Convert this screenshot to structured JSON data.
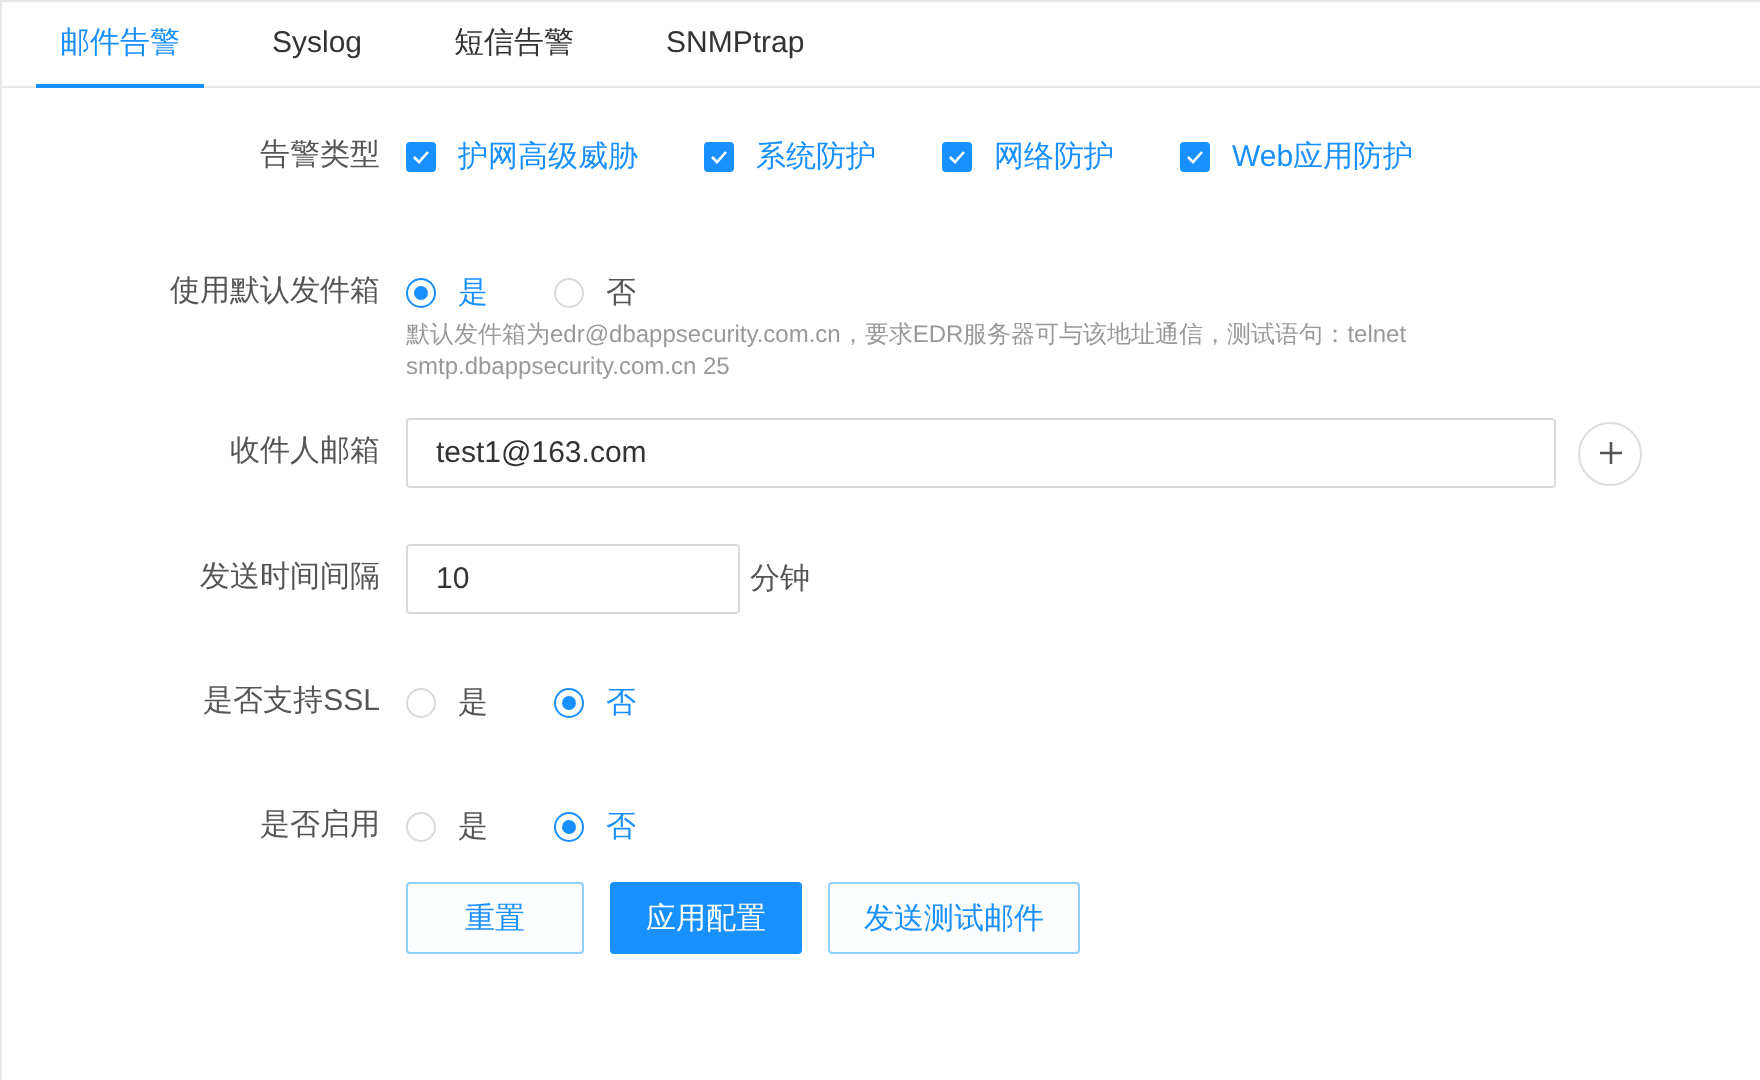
{
  "tabs": [
    {
      "label": "邮件告警",
      "selected": true
    },
    {
      "label": "Syslog",
      "selected": false
    },
    {
      "label": "短信告警",
      "selected": false
    },
    {
      "label": "SNMPtrap",
      "selected": false
    }
  ],
  "alert_types": {
    "label": "告警类型",
    "options": [
      {
        "label": "护网高级威胁",
        "checked": true
      },
      {
        "label": "系统防护",
        "checked": true
      },
      {
        "label": "网络防护",
        "checked": true
      },
      {
        "label": "Web应用防护",
        "checked": true
      }
    ]
  },
  "default_mailbox": {
    "label": "使用默认发件箱",
    "options": [
      {
        "label": "是",
        "selected": true
      },
      {
        "label": "否",
        "selected": false
      }
    ],
    "hint": "默认发件箱为edr@dbappsecurity.com.cn，要求EDR服务器可与该地址通信，测试语句：telnet smtp.dbappsecurity.com.cn 25"
  },
  "recipient": {
    "label": "收件人邮箱",
    "value": "test1@163.com"
  },
  "interval": {
    "label": "发送时间间隔",
    "value": "10",
    "unit": "分钟"
  },
  "ssl": {
    "label": "是否支持SSL",
    "options": [
      {
        "label": "是",
        "selected": false
      },
      {
        "label": "否",
        "selected": true
      }
    ]
  },
  "enabled": {
    "label": "是否启用",
    "options": [
      {
        "label": "是",
        "selected": false
      },
      {
        "label": "否",
        "selected": true
      }
    ]
  },
  "buttons": [
    {
      "label": "重置",
      "kind": "default"
    },
    {
      "label": "应用配置",
      "kind": "primary"
    },
    {
      "label": "发送测试邮件",
      "kind": "default"
    }
  ]
}
